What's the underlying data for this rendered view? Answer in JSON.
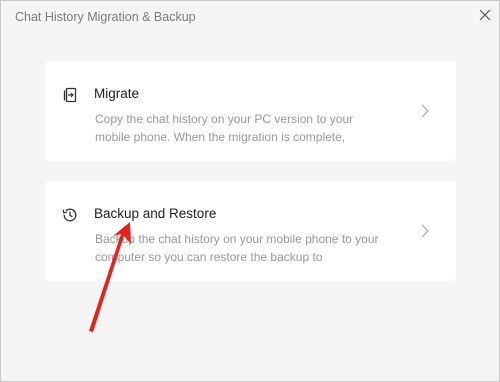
{
  "window": {
    "title": "Chat History Migration & Backup",
    "close_icon": "close-icon"
  },
  "options": [
    {
      "icon": "migrate-icon",
      "title": "Migrate",
      "description": "Copy the chat history on your PC version to your mobile phone. When the migration is complete,"
    },
    {
      "icon": "history-clock-icon",
      "title": "Backup and Restore",
      "description": "Backup the chat history on your mobile phone to your computer so you can restore the backup to"
    }
  ],
  "annotation": {
    "arrow_color": "#e8211a"
  }
}
